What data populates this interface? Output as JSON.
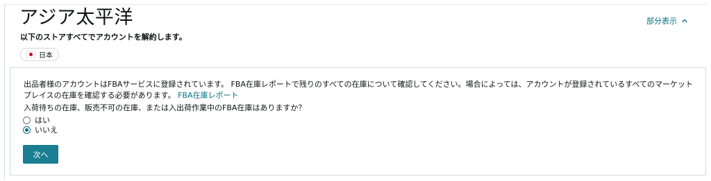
{
  "header": {
    "region_title": "アジア太平洋",
    "toggle_label": "部分表示",
    "subtitle": "以下のストアすべてでアカウントを解約します。"
  },
  "stores": [
    {
      "label": "日本",
      "flag": "japan-flag-icon"
    }
  ],
  "panel": {
    "info_text": "出品者様のアカウントはFBAサービスに登録されています。 FBA在庫レポートで残りのすべての在庫について確認してください。場合によっては、アカウントが登録されているすべてのマーケットプレイスの在庫を確認する必要があります。 ",
    "info_link": "FBA在庫レポート",
    "question": "入荷待ちの在庫、販売不可の在庫、または入出荷作業中のFBA在庫はありますか？",
    "options": [
      {
        "label": "はい",
        "selected": false
      },
      {
        "label": "いいえ",
        "selected": true
      }
    ],
    "next_button": "次へ"
  },
  "colors": {
    "link": "#007185",
    "button": "#1a7d92",
    "radio_selected": "#007185"
  }
}
